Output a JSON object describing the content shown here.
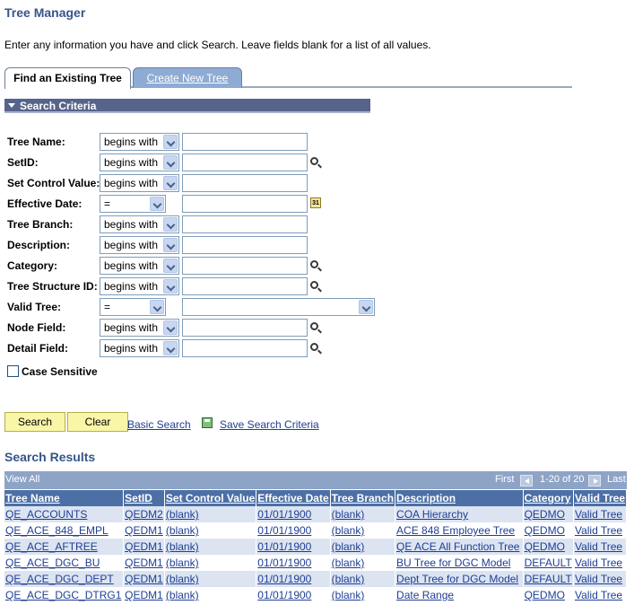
{
  "page": {
    "title": "Tree Manager",
    "instructions": "Enter any information you have and click Search. Leave fields blank for a list of all values."
  },
  "tabs": [
    {
      "label": "Find an Existing Tree",
      "active": true
    },
    {
      "label": "Create New Tree",
      "active": false
    }
  ],
  "criteria": {
    "header": "Search Criteria",
    "fields": {
      "tree_name": {
        "label": "Tree Name:",
        "operator": "begins with",
        "value": ""
      },
      "setid": {
        "label": "SetID:",
        "operator": "begins with",
        "value": ""
      },
      "set_control_value": {
        "label": "Set Control Value:",
        "operator": "begins with",
        "value": ""
      },
      "effective_date": {
        "label": "Effective Date:",
        "operator": "=",
        "value": ""
      },
      "tree_branch": {
        "label": "Tree Branch:",
        "operator": "begins with",
        "value": ""
      },
      "description": {
        "label": "Description:",
        "operator": "begins with",
        "value": ""
      },
      "category": {
        "label": "Category:",
        "operator": "begins with",
        "value": ""
      },
      "tree_structure_id": {
        "label": "Tree Structure ID:",
        "operator": "begins with",
        "value": ""
      },
      "valid_tree": {
        "label": "Valid Tree:",
        "operator": "=",
        "value": ""
      },
      "node_field": {
        "label": "Node Field:",
        "operator": "begins with",
        "value": ""
      },
      "detail_field": {
        "label": "Detail Field:",
        "operator": "begins with",
        "value": ""
      }
    },
    "case_sensitive_label": "Case Sensitive",
    "calendar_glyph": "31"
  },
  "actions": {
    "search": "Search",
    "clear": "Clear",
    "basic_search": "Basic Search",
    "save_search": "Save Search Criteria"
  },
  "results": {
    "title": "Search Results",
    "view_all": "View All",
    "first": "First",
    "range": "1-20 of 20",
    "last": "Last",
    "columns": [
      "Tree Name",
      "SetID",
      "Set Control Value",
      "Effective Date",
      "Tree Branch",
      "Description",
      "Category",
      "Valid Tree"
    ],
    "rows": [
      [
        "QE_ACCOUNTS",
        "QEDM2",
        "(blank)",
        "01/01/1900",
        "(blank)",
        "COA Hierarchy",
        "QEDMO",
        "Valid Tree"
      ],
      [
        "QE_ACE_848_EMPL",
        "QEDM1",
        "(blank)",
        "01/01/1900",
        "(blank)",
        "ACE 848 Employee Tree",
        "QEDMO",
        "Valid Tree"
      ],
      [
        "QE_ACE_AFTREE",
        "QEDM1",
        "(blank)",
        "01/01/1900",
        "(blank)",
        "QE ACE All Function Tree",
        "QEDMO",
        "Valid Tree"
      ],
      [
        "QE_ACE_DGC_BU",
        "QEDM1",
        "(blank)",
        "01/01/1900",
        "(blank)",
        "BU Tree for DGC Model",
        "DEFAULT",
        "Valid Tree"
      ],
      [
        "QE_ACE_DGC_DEPT",
        "QEDM1",
        "(blank)",
        "01/01/1900",
        "(blank)",
        "Dept Tree for DGC Model",
        "DEFAULT",
        "Valid Tree"
      ],
      [
        "QE_ACE_DGC_DTRG1",
        "QEDM1",
        "(blank)",
        "01/01/1900",
        "(blank)",
        "Date Range",
        "QEDMO",
        "Valid Tree"
      ]
    ]
  },
  "colors": {
    "title": "#35558a",
    "section_header": "#56648b",
    "grid_header": "#4c6fa6",
    "row_alt": "#dce4f1",
    "button": "#faf6a8",
    "link": "#1f3e94"
  }
}
